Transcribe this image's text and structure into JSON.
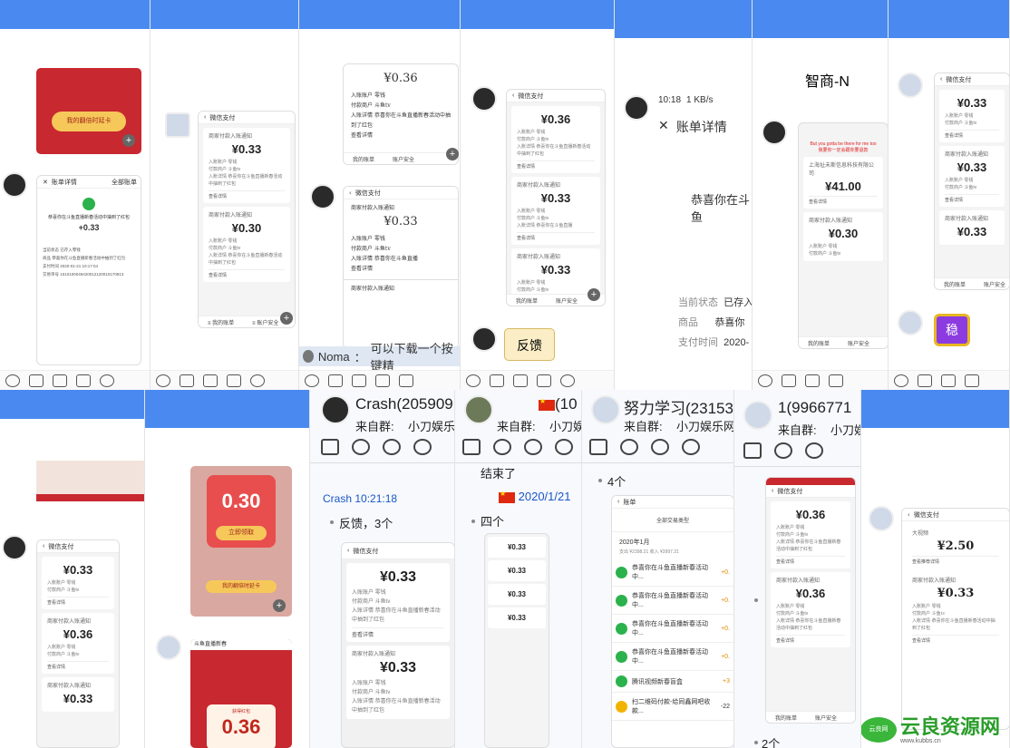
{
  "panel3": {
    "amount1": "¥0.36",
    "label_acct": "入账账户",
    "val_acct": "零钱",
    "label_payer": "付款商户",
    "val_payer": "斗鱼tv",
    "label_detail": "入账详情",
    "val_detail": "恭喜你在斗鱼直播新春活动中抽到了红包",
    "view": "查看详情",
    "amount2": "¥0.33",
    "title": "微信支付",
    "card_title": "商家付款入账通知",
    "bottom": [
      "我的账单",
      "账户安全"
    ],
    "name": "Noma",
    "msg": "可以下载一个按键精"
  },
  "panel5": {
    "status": "10:18",
    "speed": "1 KB/s",
    "title": "账单详情",
    "congrats": "恭喜你在斗鱼",
    "rows": [
      {
        "k": "当前状态",
        "v": "已存入"
      },
      {
        "k": "商品",
        "v": "恭喜你"
      },
      {
        "k": "支付时间",
        "v": "2020-"
      }
    ]
  },
  "panel6": {
    "head": "智商-N",
    "warn": "But you gotta be there for me too",
    "warn2": "我要你一定会跟你要退款",
    "company": "上海址未斯信息科技有限公司",
    "amount1": "¥41.00",
    "amount2": "¥0.30"
  },
  "panel7": {
    "amount1": "¥0.33",
    "amount2": "¥0.33",
    "amount3": "¥0.33",
    "bottom": [
      "我的账单",
      "账户安全"
    ],
    "badge": "稳"
  },
  "panel2": {
    "amount1": "¥0.33",
    "amount2": "¥0.30"
  },
  "panel1": {
    "title": "账单详情",
    "right": "全部账单",
    "congrats": "恭喜你在斗鱼直播新春活动中抽到了红包",
    "amount": "+0.33",
    "rows": [
      "当前状态  已存入零钱",
      "商品  恭喜你在斗鱼直播新春活动中抽到了红包",
      "支付时间  2020-01-21 10:17:04",
      "交易单号  1010100049420012120010170813"
    ],
    "btn": "我的翻倍时延卡"
  },
  "panel4": {
    "amount1": "¥0.36",
    "amount2": "¥0.33",
    "amount3": "¥0.33",
    "reply": "反馈",
    "bottom": [
      "我的账单",
      "账户安全"
    ]
  },
  "bottom1": {
    "amount1": "¥0.33",
    "amount2": "¥0.36",
    "amount3": "¥0.33"
  },
  "bottom2": {
    "amount1": "0.30",
    "tag": "立即领取",
    "btn": "我的翻倍时延卡",
    "amount2": "0.36",
    "title": "斗鱼直播新春",
    "sub": "获得红包"
  },
  "bottom3": {
    "name": "Crash(205909",
    "from": "来自群:",
    "group": "小刀娱乐",
    "time": "Crash  10:21:18",
    "msg": "反馈，3个",
    "ph_title": "微信支付",
    "amount1": "¥0.33",
    "acct": "零钱",
    "payer": "斗鱼tv",
    "detail": "恭喜你在斗鱼直播新春活动中抽到了红包",
    "view": "查看详情",
    "card_title": "商家付款入账通知",
    "amount2": "¥0.33"
  },
  "bottom4": {
    "name": "(10",
    "from": "来自群:",
    "group": "小刀娱",
    "done": "结束了",
    "date": "2020/1/21",
    "four": "四个",
    "amounts": [
      "¥0.33",
      "¥0.33",
      "¥0.33",
      "¥0.33"
    ]
  },
  "bottom5": {
    "name": "努力学习(23153",
    "from": "来自群:",
    "group": "小刀娱乐网",
    "count": "4个",
    "ph_title": "账单",
    "filter": "全部交易类型",
    "month": "2020年1月",
    "sum": "支出 ¥2398.21 收入 ¥3997.21",
    "items": [
      {
        "t": "恭喜你在斗鱼直播新春活动中...",
        "a": "+0."
      },
      {
        "t": "恭喜你在斗鱼直播新春活动中...",
        "a": "+0."
      },
      {
        "t": "恭喜你在斗鱼直播新春活动中...",
        "a": "+0."
      },
      {
        "t": "恭喜你在斗鱼直播新春活动中...",
        "a": "+0."
      },
      {
        "t": "腾讯视频新春盲盒",
        "a": "+3"
      },
      {
        "t": "扫二维码付款-给同鑫网吧收款...",
        "a": "-22"
      }
    ]
  },
  "bottom6": {
    "name": "1(9966771",
    "from": "来自群:",
    "group": "小刀娱",
    "ph_title": "微信支付",
    "amount1": "¥0.36",
    "acct": "零钱",
    "payer": "斗鱼tv",
    "detail": "恭喜你在斗鱼直播新春活动中抽到了红包",
    "view": "查看详情",
    "card_title": "商家付款入账通知",
    "amount2": "¥0.36",
    "bottom": [
      "我的账单",
      "账户安全"
    ],
    "count": "2个"
  },
  "bottom7": {
    "ph_title": "微信支付",
    "name": "大视频",
    "amount1": "¥2.50",
    "view": "查看推荐详情",
    "card_title": "商家付款入账通知",
    "amount2": "¥0.33",
    "acct": "零钱",
    "payer": "斗鱼tv",
    "detail": "恭喜你在斗鱼直播新春活动中抽到了红包"
  },
  "watermark": {
    "cn": "云良资源网",
    "small": "云良网",
    "url": "www.kubbs.cn"
  }
}
